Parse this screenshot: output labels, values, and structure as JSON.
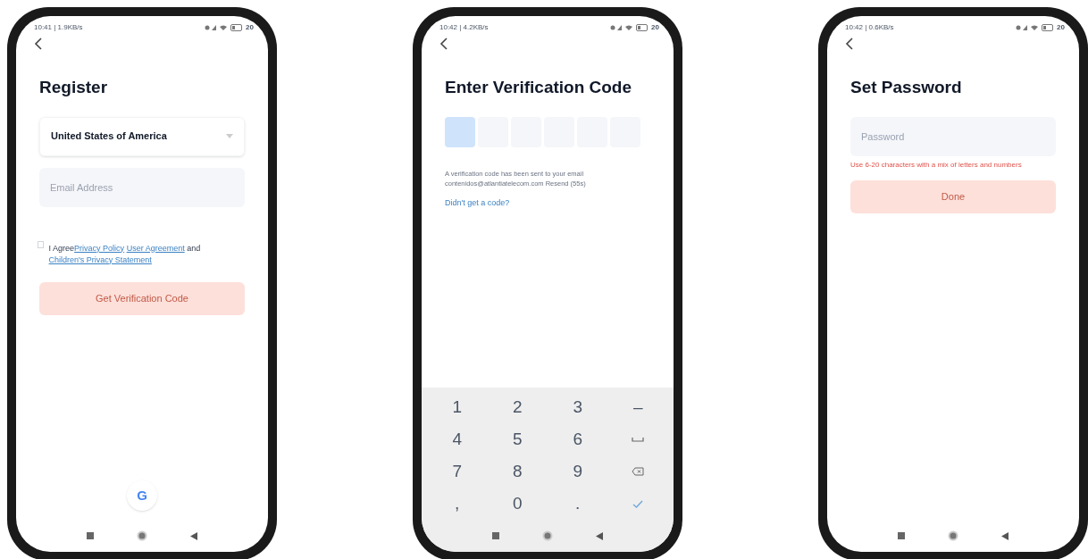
{
  "screens": [
    {
      "kind": "register",
      "status_bar": {
        "time": "10:41 | 1.9KB/s",
        "battery": "20"
      },
      "title": "Register",
      "country_select": {
        "value": "United States of America"
      },
      "email_field": {
        "placeholder": "Email Address"
      },
      "agreement": {
        "checked": false,
        "prefix": "I Agree",
        "links": [
          "Privacy Policy",
          "User Agreement"
        ],
        "joiner": "and",
        "last_link": "Children's Privacy Statement"
      },
      "button": {
        "label": "Get Verification Code",
        "disabled": true
      },
      "social_login": "G"
    },
    {
      "kind": "verify",
      "status_bar": {
        "time": "10:42 | 4.2KB/s",
        "battery": "20"
      },
      "title": "Enter Verification Code",
      "code_boxes": [
        {
          "focused": true
        },
        {
          "focused": false
        },
        {
          "focused": false
        },
        {
          "focused": false
        },
        {
          "focused": false
        },
        {
          "focused": false
        }
      ],
      "message": "A verification code has been sent to your email contenidos@atlantiatelecom.com Resend (55s)",
      "help_link": "Didn't get a code?",
      "keyboard": [
        {
          "kind": "text",
          "label": "1"
        },
        {
          "kind": "text",
          "label": "2"
        },
        {
          "kind": "text",
          "label": "3"
        },
        {
          "kind": "text",
          "label": "–"
        },
        {
          "kind": "text",
          "label": "4"
        },
        {
          "kind": "text",
          "label": "5"
        },
        {
          "kind": "text",
          "label": "6"
        },
        {
          "kind": "space"
        },
        {
          "kind": "text",
          "label": "7"
        },
        {
          "kind": "text",
          "label": "8"
        },
        {
          "kind": "text",
          "label": "9"
        },
        {
          "kind": "backspace"
        },
        {
          "kind": "text",
          "label": ","
        },
        {
          "kind": "text",
          "label": "0"
        },
        {
          "kind": "text",
          "label": "."
        },
        {
          "kind": "done"
        }
      ]
    },
    {
      "kind": "password",
      "status_bar": {
        "time": "10:42 | 0.6KB/s",
        "battery": "20"
      },
      "title": "Set Password",
      "password_field": {
        "placeholder": "Password"
      },
      "hint": "Use 6-20 characters with a mix of letters and numbers",
      "button": {
        "label": "Done",
        "disabled": true
      }
    }
  ]
}
